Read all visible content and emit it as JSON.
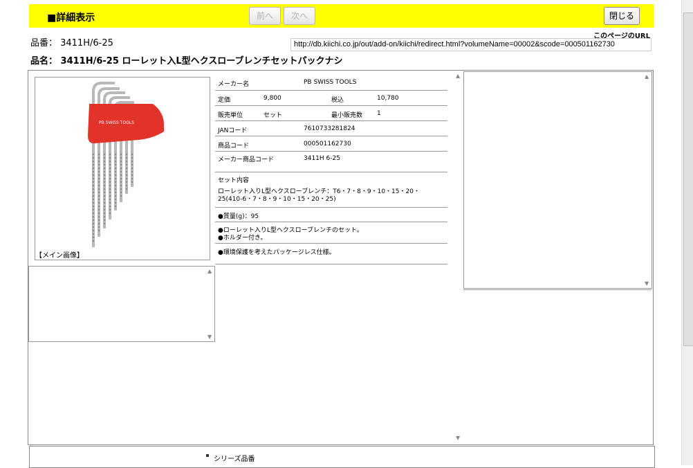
{
  "header": {
    "title": "■詳細表示",
    "prev_label": "前へ",
    "next_label": "次へ",
    "close_label": "閉じる"
  },
  "product": {
    "hinban": "品番： 3411H/6-25",
    "hinmei": "品名： 3411H/6-25 ローレット入L型ヘクスローブレンチセットパックナシ"
  },
  "url": {
    "label": "このページのURL",
    "value": "http://db.kiichi.co.jp/out/add-on/kiichi/redirect.html?volumeName=00002&scode=000501162730"
  },
  "image": {
    "caption": "【メイン画像】",
    "brand": "PB SWISS TOOLS"
  },
  "spec": {
    "maker_label": "メーカー名",
    "maker_value": "PB SWISS TOOLS",
    "price_label": "定価",
    "price_value": "9,800",
    "tax_label": "税込",
    "tax_value": "10,780",
    "unit_label": "販売単位",
    "unit_value": "セット",
    "min_label": "最小販売数",
    "min_value": "1",
    "jan_label": "JANコード",
    "jan_value": "7610733281824",
    "code_label": "商品コード",
    "code_value": "000501162730",
    "maker_code_label": "メーカー商品コード",
    "maker_code_value": "3411H 6-25",
    "set_label": "セット内容",
    "set_value": "ローレット入りL型ヘクスローブレンチ：T6・7・8・9・10・15・20・25(410-6・7・8・9・10・15・20・25)",
    "weight": "●質量(g)：95",
    "feature1": "●ローレット入りL型ヘクスローブレンチのセット。",
    "feature2": "●ホルダー付き。",
    "feature3": "●環境保護を考えたパッケージレス仕様。"
  },
  "series": {
    "label": "シリーズ品番"
  },
  "colors": {
    "header_bg": "#ffff00",
    "holder_red": "#e2332b"
  }
}
